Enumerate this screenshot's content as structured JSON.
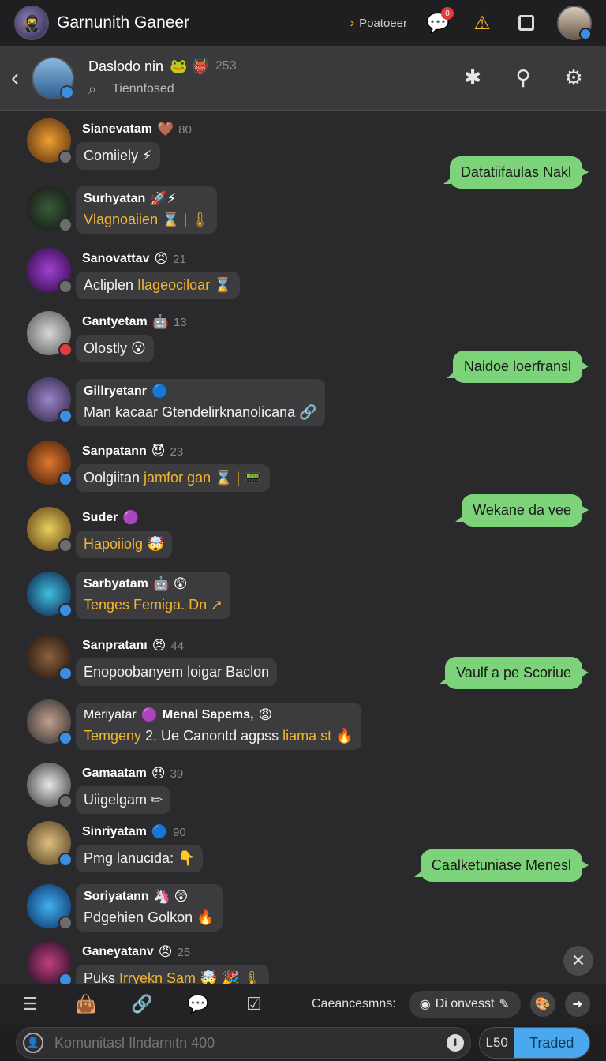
{
  "app": {
    "title": "Garnunith Ganeer",
    "top_link": "Poatoeer",
    "notif_count": "0"
  },
  "header": {
    "name": "Daslodo nin",
    "emoji": "🐸 👹",
    "count": "253",
    "subtitle": "Tiennfosed"
  },
  "messages": [
    {
      "name": "Sianevatam",
      "emoji": "🤎",
      "count": "80",
      "text": "Comiiely ⚡",
      "hl": ""
    },
    {
      "name": "Surhyatan",
      "emoji": "🚀⚡",
      "count": "",
      "text": "",
      "hl": "Vlagnoaiien ⌛ | 🌡"
    },
    {
      "name": "Sanovattav",
      "emoji": "😠",
      "count": "21",
      "text": "Acliplen ",
      "hl": "Ilageociloar ⌛"
    },
    {
      "name": "Gantyetam",
      "emoji": "🤖",
      "count": "13",
      "text": "Olostly 😮",
      "hl": ""
    },
    {
      "name": "Gillryetanr",
      "emoji": "🔵",
      "count": "",
      "text": "Man kacaar Gtendelirknanolicana 🔗",
      "hl": ""
    },
    {
      "name": "Sanpatann",
      "emoji": "😈",
      "count": "23",
      "text": "Oolgiitan ",
      "hl": "jamfor gan ⌛ | 📟"
    },
    {
      "name": "Suder",
      "emoji": "🟣",
      "count": "",
      "text": "",
      "hl": "Hapoiiolg 🤯"
    },
    {
      "name": "Sarbyatam",
      "emoji": "🤖 😲",
      "count": "",
      "text": "",
      "hl": "Tenges Femiga. Dn ↗"
    },
    {
      "name": "Sanpratanı",
      "emoji": "😠",
      "count": "44",
      "text": "Enopoobanyem loigar Baclon",
      "hl": ""
    },
    {
      "name": "Meriyatar",
      "emoji": "🟣",
      "name2": "Menal Sapems,",
      "emoji2": "😡",
      "text": "Temgeny ",
      "text_mid": "2. Ue Canontd agpss ",
      "hl": "liama st 🔥"
    },
    {
      "name": "Gamaatam",
      "emoji": "😠",
      "count": "39",
      "text": "Uiigelgam ✏",
      "hl": ""
    },
    {
      "name": "Sinriyatam",
      "emoji": "🔵",
      "count": "90",
      "text": "Pmg lanucida: 👇",
      "hl": ""
    },
    {
      "name": "Soriyatann",
      "emoji": "🦄 😲",
      "count": "",
      "text": "Pdgehien Golkon 🔥",
      "hl": ""
    },
    {
      "name": "Ganeyatanv",
      "emoji": "😠",
      "count": "25",
      "text": "Puks ",
      "hl": "Irryekn Sam 🤯 🎉 🌡"
    }
  ],
  "mine": [
    "Datatiifaulas Nakl",
    "Naidoe loerfransl",
    "Wekane da vee",
    "Vaulf a pe Scoriue",
    "Caalketuniase Menesl"
  ],
  "toolbar": {
    "label": "Caeancesmns:",
    "pill": "Di onvesst"
  },
  "input": {
    "placeholder": "Komunitasl Ilndarnitn 400",
    "seg1": "L50",
    "seg2": "Traded"
  },
  "colors": {
    "accent": "#3a8fe0",
    "bubble_mine": "#7dd37a",
    "highlight": "#f2b530"
  }
}
